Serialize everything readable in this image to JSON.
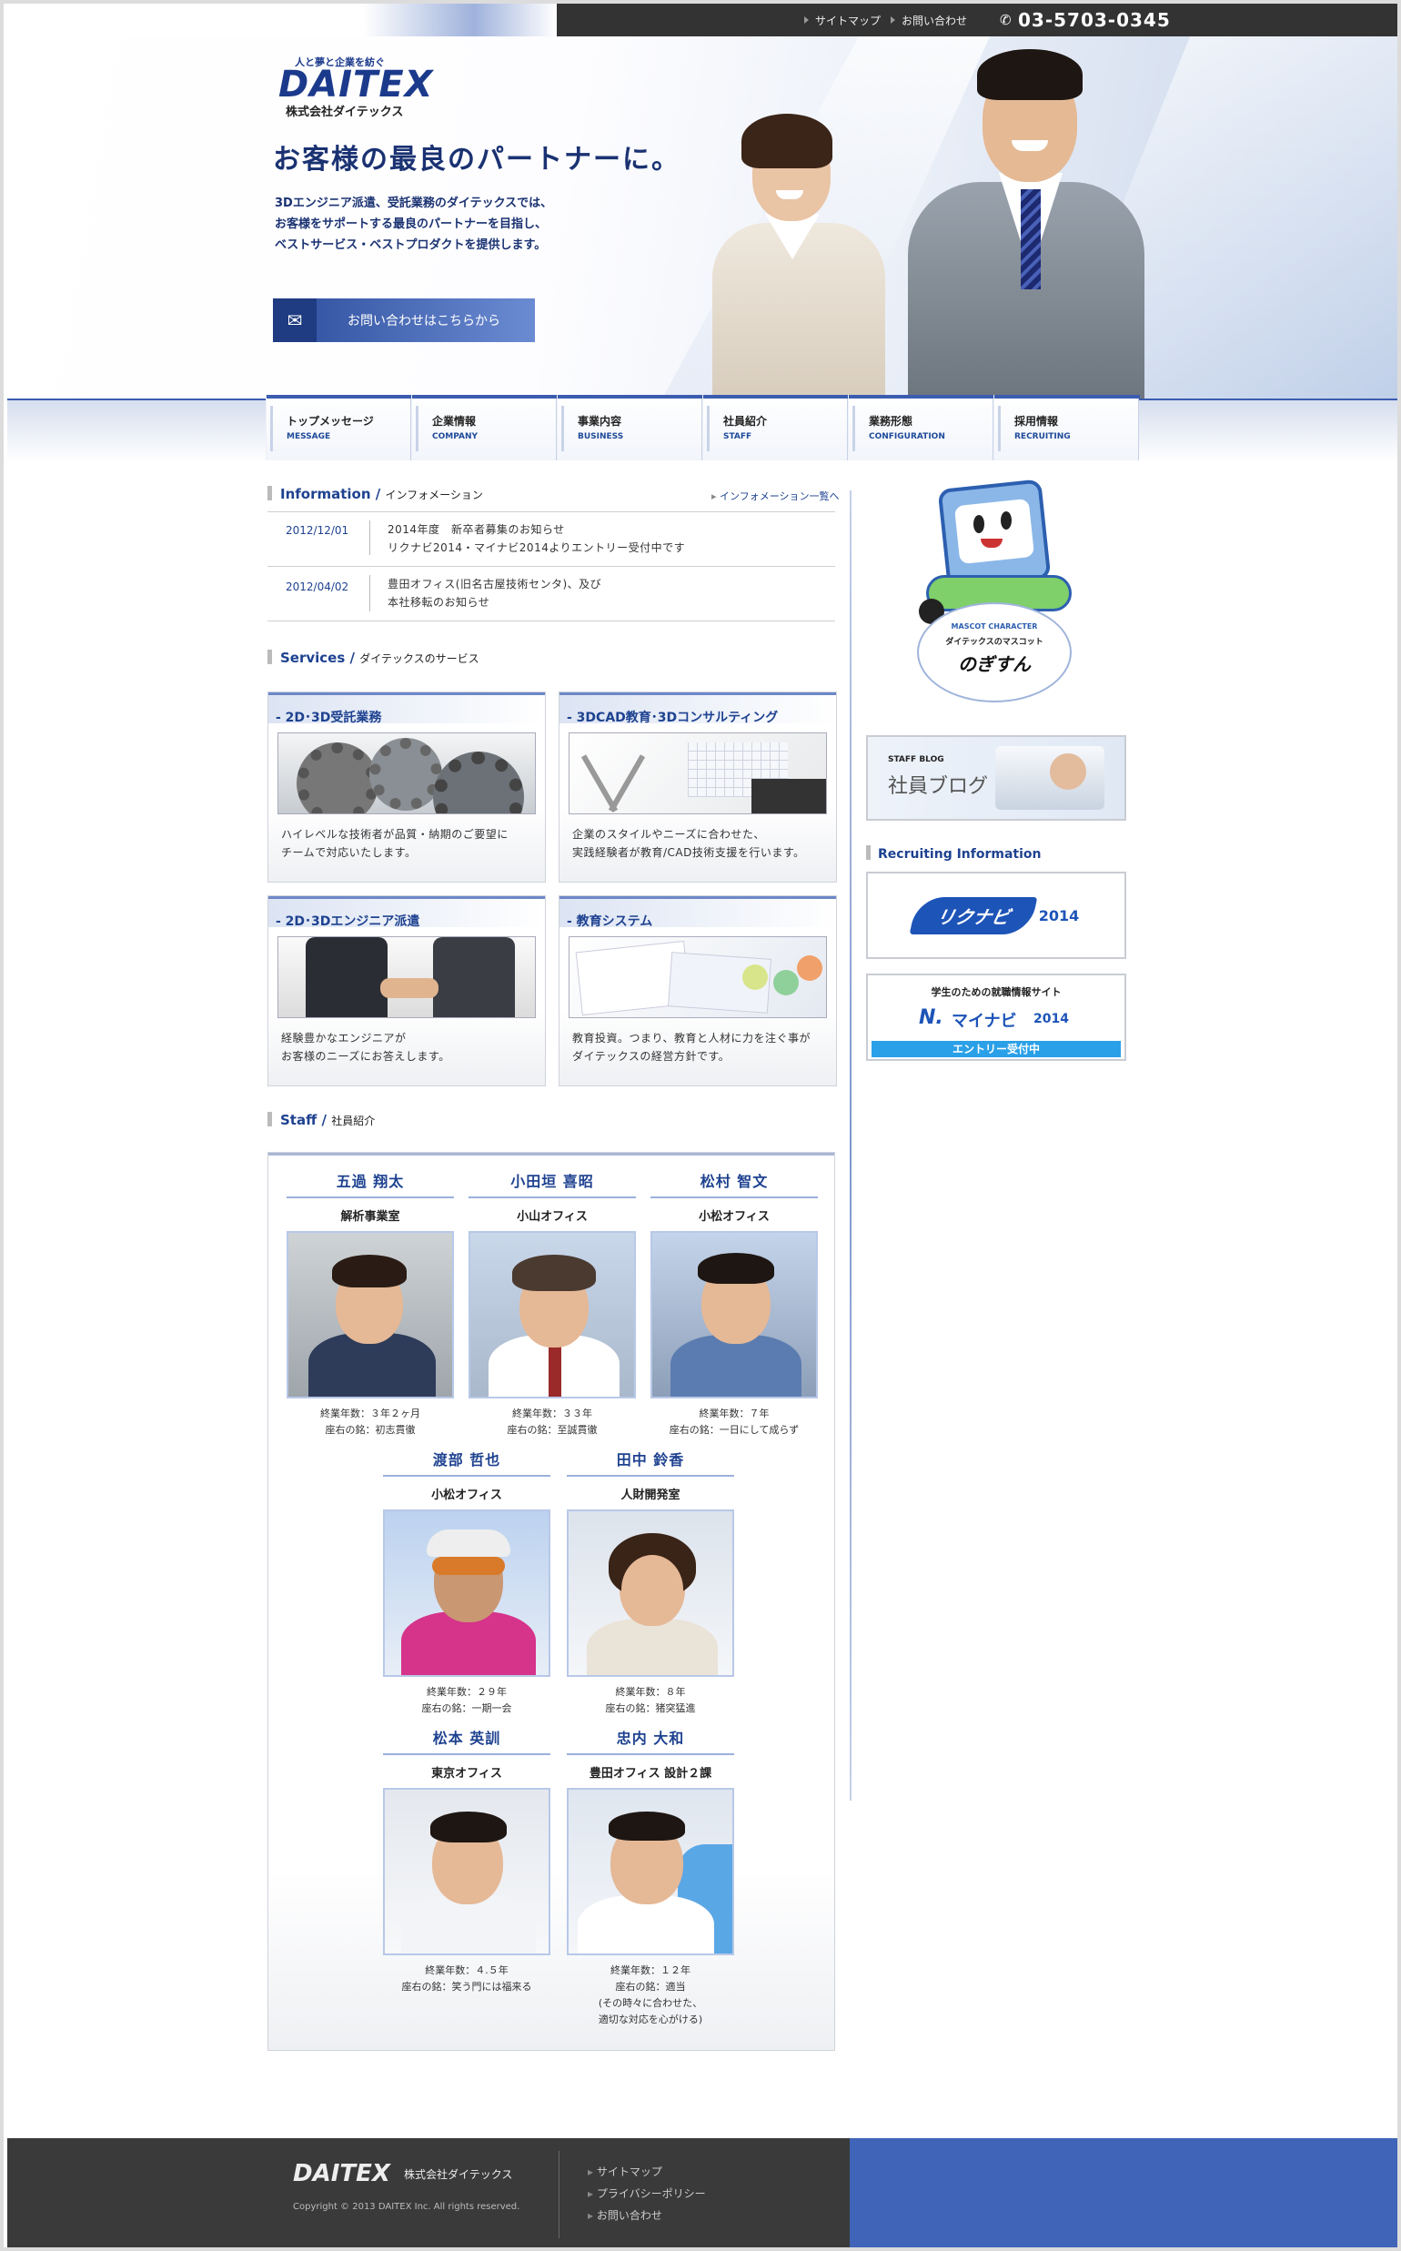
{
  "topbar": {
    "links": [
      "サイトマップ",
      "お問い合わせ"
    ],
    "phone": "03-5703-0345"
  },
  "hero": {
    "logo_tagline": "人と夢と企業を紡ぐ",
    "logo": "DAITEX",
    "company": "株式会社ダイテックス",
    "headline": "お客様の最良のパートナーに。",
    "lead": [
      "3Dエンジニア派遣、受託業務のダイテックスでは、",
      "お客様をサポートする最良のパートナーを目指し、",
      "ベストサービス・ベストプロダクトを提供します。"
    ],
    "cta_label": "お問い合わせはこちらから"
  },
  "nav": [
    {
      "jp": "トップメッセージ",
      "en": "MESSAGE"
    },
    {
      "jp": "企業情報",
      "en": "COMPANY"
    },
    {
      "jp": "事業内容",
      "en": "BUSINESS"
    },
    {
      "jp": "社員紹介",
      "en": "STAFF"
    },
    {
      "jp": "業務形態",
      "en": "CONFIGURATION"
    },
    {
      "jp": "採用情報",
      "en": "RECRUITING"
    }
  ],
  "information": {
    "title": "Information",
    "title_jp": "インフォメーション",
    "more": "インフォメーション一覧へ",
    "items": [
      {
        "date": "2012/12/01",
        "lines": [
          "2014年度　新卒者募集のお知らせ",
          "リクナビ2014・マイナビ2014よりエントリー受付中です"
        ]
      },
      {
        "date": "2012/04/02",
        "lines": [
          "豊田オフィス(旧名古屋技術センタ)、及び",
          "本社移転のお知らせ"
        ]
      }
    ]
  },
  "services": {
    "title": "Services",
    "title_jp": "ダイテックスのサービス",
    "items": [
      {
        "title": "- 2D･3D受託業務",
        "lines": [
          "ハイレベルな技術者が品質・納期のご要望に",
          "チームで対応いたします。"
        ]
      },
      {
        "title": "- 3DCAD教育･3Dコンサルティング",
        "lines": [
          "企業のスタイルやニーズに合わせた、",
          "実践経験者が教育/CAD技術支援を行います。"
        ]
      },
      {
        "title": "- 2D･3Dエンジニア派遣",
        "lines": [
          "経験豊かなエンジニアが",
          "お客様のニーズにお答えします。"
        ]
      },
      {
        "title": "- 教育システム",
        "lines": [
          "教育投資。つまり、教育と人材に力を注ぐ事が",
          "ダイテックスの経営方針です。"
        ]
      }
    ]
  },
  "staff": {
    "title": "Staff",
    "title_jp": "社員紹介",
    "members": [
      {
        "name": "五過 翔太",
        "dept": "解析事業室",
        "years": "終業年数：３年２ヶ月",
        "motto": "座右の銘：初志貫徹"
      },
      {
        "name": "小田垣 喜昭",
        "dept": "小山オフィス",
        "years": "終業年数：３３年",
        "motto": "座右の銘：至誠貫徹"
      },
      {
        "name": "松村 智文",
        "dept": "小松オフィス",
        "years": "終業年数：７年",
        "motto": "座右の銘：一日にして成らず"
      },
      {
        "name": "渡部 哲也",
        "dept": "小松オフィス",
        "years": "終業年数：２９年",
        "motto": "座右の銘：一期一会"
      },
      {
        "name": "田中 鈴香",
        "dept": "人財開発室",
        "years": "終業年数：８年",
        "motto": "座右の銘：猪突猛進"
      },
      {
        "name": "松本 英訓",
        "dept": "東京オフィス",
        "years": "終業年数：４.５年",
        "motto": "座右の銘：笑う門には福来る"
      },
      {
        "name": "忠内 大和",
        "dept": "豊田オフィス 設計２課",
        "years": "終業年数：１２年",
        "motto": "座右の銘：適当",
        "note": [
          "(その時々に合わせた、",
          "適切な対応を心がける)"
        ]
      }
    ]
  },
  "sidebar": {
    "mascot_en": "MASCOT CHARACTER",
    "mascot_jp": "ダイテックスのマスコット",
    "mascot_name": "のぎすん",
    "blog_en": "STAFF BLOG",
    "blog_jp": "社員ブログ",
    "recruit_title": "Recruiting Information",
    "rikunabi": "リクナビ",
    "rikunabi_year": "2014",
    "mynavi_caption": "学生のための就職情報サイト",
    "mynavi": "マイナビ",
    "mynavi_year": "2014",
    "mynavi_entry": "エントリー受付中"
  },
  "footer": {
    "logo": "DAITEX",
    "company": "株式会社ダイテックス",
    "copyright": "Copyright © 2013 DAITEX Inc. All rights reserved.",
    "links": [
      "サイトマップ",
      "プライバシーポリシー",
      "お問い合わせ"
    ]
  },
  "colors": {
    "brand": "#1e4290",
    "accent": "#3f64b8",
    "dark": "#333333"
  }
}
